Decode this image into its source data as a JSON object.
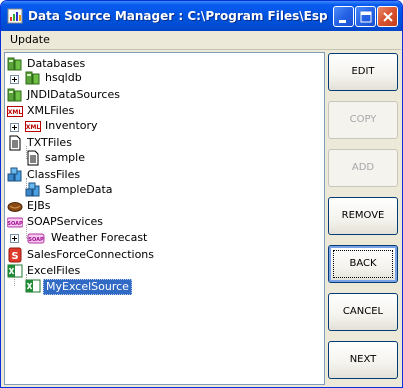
{
  "window": {
    "title": "Data Source Manager : C:\\Program Files\\Espressdashboard"
  },
  "menu": {
    "items": [
      "Update"
    ]
  },
  "tree": [
    {
      "label": "Databases",
      "icon": "database-icon"
    },
    {
      "label": "hsqldb",
      "icon": "database-icon"
    },
    {
      "label": "JNDIDataSources",
      "icon": "database-icon"
    },
    {
      "label": "XMLFiles",
      "icon": "xml-icon"
    },
    {
      "label": "Inventory",
      "icon": "xml-icon"
    },
    {
      "label": "TXTFiles",
      "icon": "text-file-icon"
    },
    {
      "label": "sample",
      "icon": "text-file-icon"
    },
    {
      "label": "ClassFiles",
      "icon": "class-icon"
    },
    {
      "label": "SampleData",
      "icon": "class-icon"
    },
    {
      "label": "EJBs",
      "icon": "ejb-bean-icon"
    },
    {
      "label": "SOAPServices",
      "icon": "soap-icon"
    },
    {
      "label": "Weather Forecast",
      "icon": "soap-icon"
    },
    {
      "label": "SalesForceConnections",
      "icon": "salesforce-icon"
    },
    {
      "label": "ExcelFiles",
      "icon": "excel-icon"
    },
    {
      "label": "MyExcelSource",
      "icon": "excel-icon",
      "selected": true
    }
  ],
  "buttons": {
    "edit": "EDIT",
    "copy": "COPY",
    "add": "ADD",
    "remove": "REMOVE",
    "back": "BACK",
    "cancel": "CANCEL",
    "next": "NEXT"
  },
  "button_states": {
    "copy": "disabled",
    "add": "disabled",
    "back": "focused"
  }
}
